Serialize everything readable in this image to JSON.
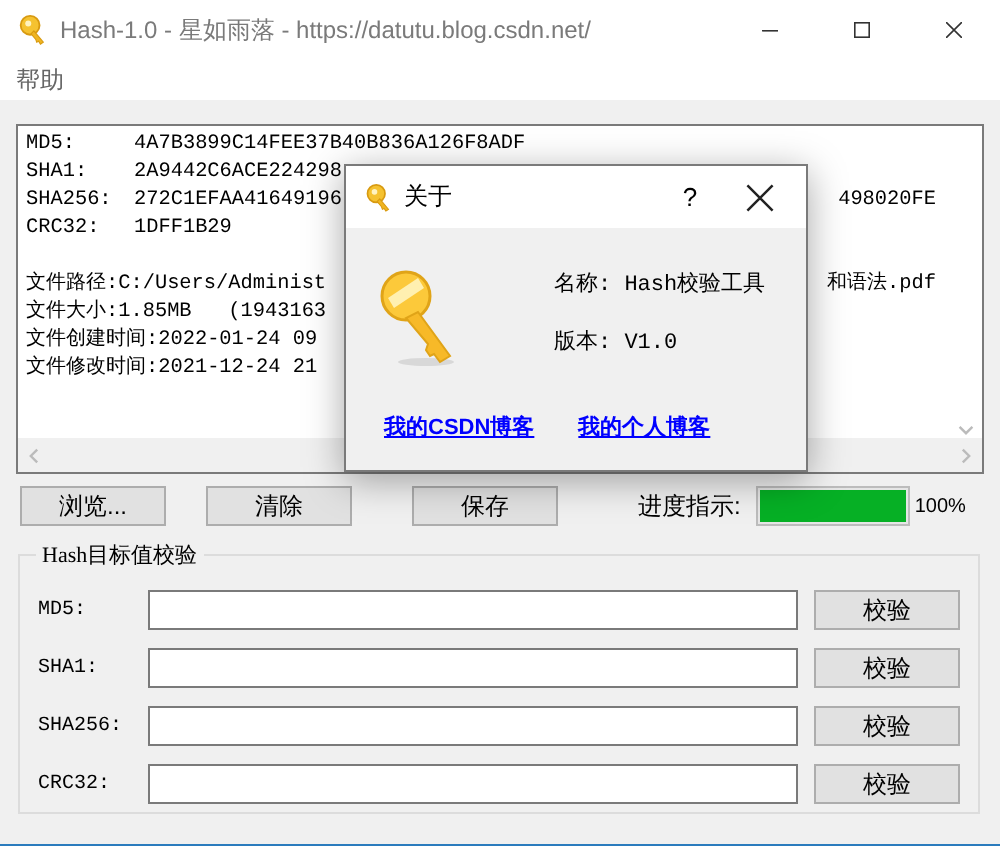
{
  "window": {
    "title": "Hash-1.0 - 星如雨落 - https://datutu.blog.csdn.net/"
  },
  "menu": [
    "帮助"
  ],
  "output": {
    "hashes": [
      {
        "label": "MD5:",
        "value": "4A7B3899C14FEE37B40B836A126F8ADF"
      },
      {
        "label": "SHA1:",
        "value": "2A9442C6ACE224298"
      },
      {
        "label": "SHA256:",
        "value": "272C1EFAA41649196",
        "tail": "498020FE"
      },
      {
        "label": "CRC32:",
        "value": "1DFF1B29"
      }
    ],
    "info": [
      {
        "text": "文件路径:C:/Users/Administ",
        "tail": "和语法.pdf"
      },
      {
        "text": "文件大小:1.85MB   (1943163"
      },
      {
        "text": "文件创建时间:2022-01-24 09"
      },
      {
        "text": "文件修改时间:2021-12-24 21"
      }
    ]
  },
  "actions": [
    {
      "label": "浏览..."
    },
    {
      "label": "清除"
    },
    {
      "label": "保存"
    }
  ],
  "progress": {
    "label": "进度指示:",
    "level": 1.0,
    "reading": "100%"
  },
  "verify": {
    "title": "Hash目标值校验",
    "rows": [
      {
        "label": "MD5:",
        "button": "校验"
      },
      {
        "label": "SHA1:",
        "button": "校验"
      },
      {
        "label": "SHA256:",
        "button": "校验"
      },
      {
        "label": "CRC32:",
        "button": "校验"
      }
    ]
  },
  "about": {
    "title": "关于",
    "help": "?",
    "name": "名称: Hash校验工具",
    "version": "版本: V1.0",
    "links": [
      "我的CSDN博客",
      "我的个人博客"
    ]
  }
}
